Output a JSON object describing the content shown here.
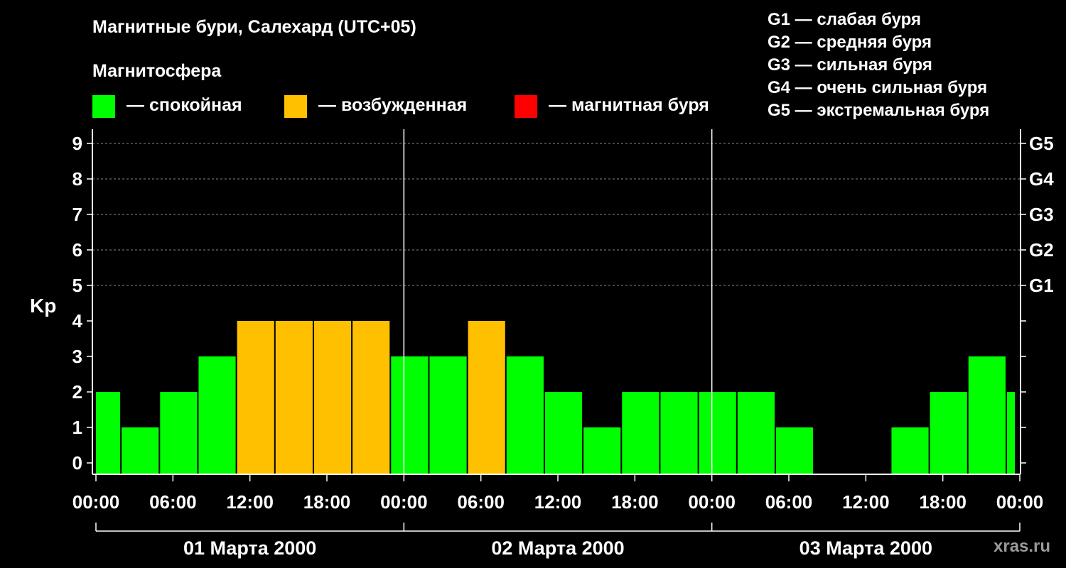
{
  "header": {
    "title": "Магнитные бури, Салехард (UTC+05)",
    "subtitle": "Магнитосфера"
  },
  "legend": [
    {
      "label": "— спокойная",
      "color": "#00ff00"
    },
    {
      "label": "— возбужденная",
      "color": "#ffc000"
    },
    {
      "label": "— магнитная буря",
      "color": "#ff0000"
    }
  ],
  "g_legend": [
    "G1 — слабая буря",
    "G2 — средняя буря",
    "G3 — сильная буря",
    "G4 — очень сильная буря",
    "G5 — экстремальная буря"
  ],
  "watermark": "xras.ru",
  "chart_data": {
    "type": "bar",
    "ylabel": "Kp",
    "ylim": [
      0,
      9
    ],
    "yticks": [
      "0",
      "1",
      "2",
      "3",
      "4",
      "5",
      "6",
      "7",
      "8",
      "9"
    ],
    "right_ticks": [
      {
        "value": 5,
        "label": "G1"
      },
      {
        "value": 6,
        "label": "G2"
      },
      {
        "value": 7,
        "label": "G3"
      },
      {
        "value": 8,
        "label": "G4"
      },
      {
        "value": 9,
        "label": "G5"
      }
    ],
    "xtick_labels": [
      "00:00",
      "06:00",
      "12:00",
      "18:00",
      "00:00",
      "06:00",
      "12:00",
      "18:00",
      "00:00",
      "06:00",
      "12:00",
      "18:00",
      "00:00"
    ],
    "days": [
      "01 Марта 2000",
      "02 Марта 2000",
      "03 Марта 2000"
    ],
    "grid": true,
    "colors": {
      "quiet": "#00ff00",
      "active": "#ffc000",
      "storm": "#ff0000"
    },
    "bars": [
      {
        "time": "01 Марта 2000 00:00",
        "kp": 2,
        "level": "quiet"
      },
      {
        "time": "01 Марта 2000 03:00",
        "kp": 1,
        "level": "quiet"
      },
      {
        "time": "01 Марта 2000 06:00",
        "kp": 2,
        "level": "quiet"
      },
      {
        "time": "01 Марта 2000 09:00",
        "kp": 3,
        "level": "quiet"
      },
      {
        "time": "01 Марта 2000 12:00",
        "kp": 4,
        "level": "active"
      },
      {
        "time": "01 Марта 2000 15:00",
        "kp": 4,
        "level": "active"
      },
      {
        "time": "01 Марта 2000 18:00",
        "kp": 4,
        "level": "active"
      },
      {
        "time": "01 Марта 2000 21:00",
        "kp": 4,
        "level": "active"
      },
      {
        "time": "02 Марта 2000 00:00",
        "kp": 3,
        "level": "quiet"
      },
      {
        "time": "02 Марта 2000 03:00",
        "kp": 3,
        "level": "quiet"
      },
      {
        "time": "02 Марта 2000 06:00",
        "kp": 4,
        "level": "active"
      },
      {
        "time": "02 Марта 2000 09:00",
        "kp": 3,
        "level": "quiet"
      },
      {
        "time": "02 Марта 2000 12:00",
        "kp": 2,
        "level": "quiet"
      },
      {
        "time": "02 Марта 2000 15:00",
        "kp": 1,
        "level": "quiet"
      },
      {
        "time": "02 Марта 2000 18:00",
        "kp": 2,
        "level": "quiet"
      },
      {
        "time": "02 Марта 2000 21:00",
        "kp": 2,
        "level": "quiet"
      },
      {
        "time": "03 Марта 2000 00:00",
        "kp": 2,
        "level": "quiet"
      },
      {
        "time": "03 Марта 2000 03:00",
        "kp": 2,
        "level": "quiet"
      },
      {
        "time": "03 Марта 2000 06:00",
        "kp": 1,
        "level": "quiet"
      },
      {
        "time": "03 Марта 2000 09:00",
        "kp": 0,
        "level": "quiet"
      },
      {
        "time": "03 Марта 2000 12:00",
        "kp": 0,
        "level": "quiet"
      },
      {
        "time": "03 Марта 2000 15:00",
        "kp": 1,
        "level": "quiet"
      },
      {
        "time": "03 Марта 2000 18:00",
        "kp": 2,
        "level": "quiet"
      },
      {
        "time": "03 Марта 2000 21:00",
        "kp": 3,
        "level": "quiet"
      },
      {
        "time": "04 Марта 2000 00:00",
        "kp": 2,
        "level": "quiet"
      }
    ]
  }
}
